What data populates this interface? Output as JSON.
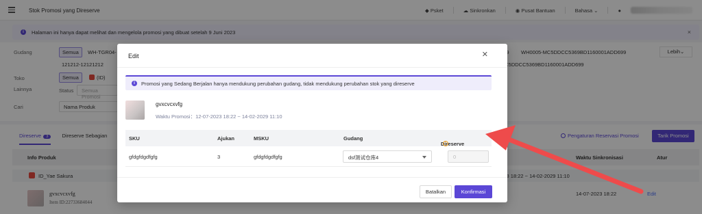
{
  "topbar": {
    "title": "Stok Promosi yang Direserve",
    "pesket": "Psket",
    "sync": "Sinkronkan",
    "help": "Pusat Bantuan",
    "language": "Bahasa"
  },
  "notice": {
    "text": "Halaman ini hanya dapat melihat dan mengelola promosi yang dibuat setelah 9 Juni 2023"
  },
  "filters": {
    "gudang_label": "Gudang",
    "gudang_all": "Semua",
    "gudang_item1": "WH-TGR04-",
    "gudang_item2": "121212-12121212",
    "gudang_right1": "699",
    "gudang_right2": "WH0005-MC5DDCC5369BD1160001ADD699",
    "gudang_right3": "MC5DDCC5369BD1160001ADD699",
    "more": "Lebih",
    "toko_label": "Toko",
    "toko_all": "Semua",
    "toko_item": "(ID)",
    "lainnya_label": "Lainnya",
    "status_label": "Status",
    "status_placeholder": "Semua Promosi",
    "cari_label": "Cari",
    "cari_field": "Nama Produk"
  },
  "main": {
    "tab_reserved": "Direserve",
    "tab_reserved_count": "3",
    "tab_partial": "Direserve Sebagian",
    "reserve_settings": "Pengaturan Reservasi Promosi",
    "pull_button": "Tarik Promosi",
    "col_product": "Info Produk",
    "col_sync": "Waktu Sinkronisasi",
    "col_action": "Atur",
    "shop_name": "ID_Yae Sakura",
    "shop_range": "2023 18:22 ~ 14-02-2029 11:10",
    "product_name": "gvxcvcxvfg",
    "product_id": "Item ID:22733684044",
    "sync_time": "14-07-2023 18:22",
    "edit": "Edit"
  },
  "modal": {
    "title": "Edit",
    "notice": "Promosi yang Sedang Berjalan hanya mendukung perubahan gudang, tidak mendukung perubahan stok yang direserve",
    "product_name": "gvxcvcxvfg",
    "period_label": "Waktu Promosi：",
    "period_value": "12-07-2023 18:22 ~ 14-02-2029 11:10",
    "columns": {
      "sku": "SKU",
      "ajukan": "Ajukan",
      "msku": "MSKU",
      "gudang": "Gudang",
      "direserve": "Direserve"
    },
    "row": {
      "sku": "gfdgfdgdfgfg",
      "ajukan": "3",
      "msku": "gfdgfdgdfgfg",
      "gudang": "dsf测试仓库4",
      "direserve_placeholder": "0"
    },
    "cancel": "Batalkan",
    "confirm": "Konfirmasi"
  },
  "colors": {
    "accent": "#5b47d6",
    "arrow": "#ee4b4b",
    "link": "#4a6cf7"
  }
}
